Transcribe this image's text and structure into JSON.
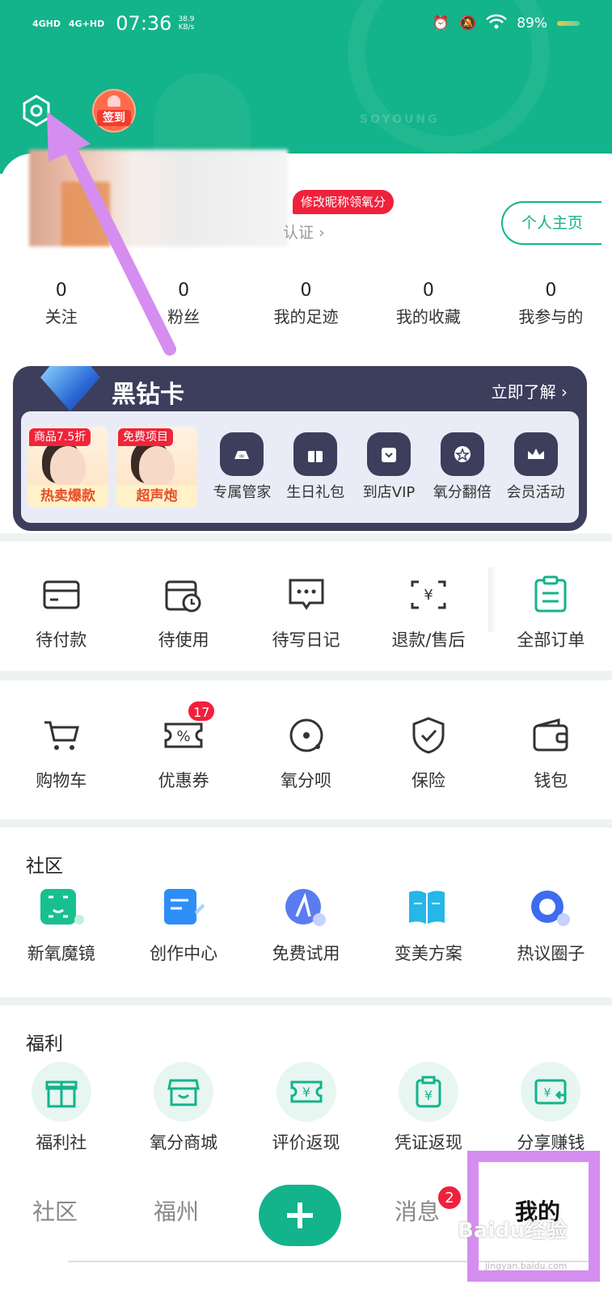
{
  "status_bar": {
    "network1": "4GHD",
    "network2": "4G+HD",
    "time": "07:36",
    "speed_value": "38.9",
    "speed_unit": "KB/s",
    "battery": "89%"
  },
  "header": {
    "signin_label": "签到",
    "watermark": "SOYOUNG"
  },
  "profile": {
    "nickname_badge": "修改昵称领氧分",
    "verify_text": "认证",
    "homepage_button": "个人主页",
    "stats": [
      {
        "value": "0",
        "label": "关注"
      },
      {
        "value": "0",
        "label": "粉丝"
      },
      {
        "value": "0",
        "label": "我的足迹"
      },
      {
        "value": "0",
        "label": "我的收藏"
      },
      {
        "value": "0",
        "label": "我参与的"
      }
    ]
  },
  "vip_card": {
    "title": "黑钻卡",
    "more": "立即了解",
    "promos": [
      {
        "tag": "商品7.5折",
        "caption": "热卖爆款"
      },
      {
        "tag": "免费项目",
        "caption": "超声炮"
      }
    ],
    "items": [
      {
        "label": "专属管家",
        "icon": "butler-icon"
      },
      {
        "label": "生日礼包",
        "icon": "gift-icon"
      },
      {
        "label": "到店VIP",
        "icon": "shop-icon"
      },
      {
        "label": "氧分翻倍",
        "icon": "star-icon"
      },
      {
        "label": "会员活动",
        "icon": "crown-icon"
      }
    ]
  },
  "orders": {
    "items": [
      {
        "label": "待付款",
        "icon": "card-icon"
      },
      {
        "label": "待使用",
        "icon": "calendar-clock-icon"
      },
      {
        "label": "待写日记",
        "icon": "chat-dots-icon"
      },
      {
        "label": "退款/售后",
        "icon": "yen-refund-icon"
      },
      {
        "label": "全部订单",
        "icon": "clipboard-icon"
      }
    ]
  },
  "tools": {
    "items": [
      {
        "label": "购物车",
        "icon": "cart-icon"
      },
      {
        "label": "优惠券",
        "icon": "coupon-icon",
        "badge": "17"
      },
      {
        "label": "氧分呗",
        "icon": "disc-icon"
      },
      {
        "label": "保险",
        "icon": "shield-icon"
      },
      {
        "label": "钱包",
        "icon": "wallet-icon"
      }
    ]
  },
  "community": {
    "title": "社区",
    "items": [
      {
        "label": "新氧魔镜",
        "icon": "face-scan-icon"
      },
      {
        "label": "创作中心",
        "icon": "note-icon"
      },
      {
        "label": "免费试用",
        "icon": "trial-icon"
      },
      {
        "label": "变美方案",
        "icon": "book-icon"
      },
      {
        "label": "热议圈子",
        "icon": "bubble-icon"
      }
    ]
  },
  "welfare": {
    "title": "福利",
    "items": [
      {
        "label": "福利社",
        "icon": "gift-box-icon"
      },
      {
        "label": "氧分商城",
        "icon": "store-icon"
      },
      {
        "label": "评价返现",
        "icon": "yen-ticket-icon"
      },
      {
        "label": "凭证返现",
        "icon": "yen-bag-icon"
      },
      {
        "label": "分享赚钱",
        "icon": "share-money-icon"
      }
    ]
  },
  "bottom_nav": {
    "community": "社区",
    "city": "福州",
    "messages": "消息",
    "messages_badge": "2",
    "mine": "我的"
  },
  "watermark": {
    "baidu": "Baidu经验",
    "url": "jingyan.baidu.com"
  },
  "colors": {
    "brand_green": "#13b38b",
    "badge_red": "#f1203b",
    "vip_dark": "#3c3e5c",
    "annotation_purple": "#d58ef0"
  }
}
